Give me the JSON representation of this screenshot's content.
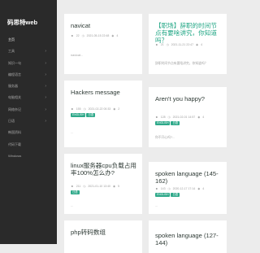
{
  "site": {
    "logo": "码思特web"
  },
  "nav": [
    {
      "label": "主页",
      "active": true,
      "arrow": ""
    },
    {
      "label": "工具",
      "active": false,
      "arrow": "›"
    },
    {
      "label": "知识一句",
      "active": false,
      "arrow": "›"
    },
    {
      "label": "编程语言",
      "active": false,
      "arrow": "›"
    },
    {
      "label": "服务器",
      "active": false,
      "arrow": "›"
    },
    {
      "label": "电脑相关",
      "active": false,
      "arrow": "›"
    },
    {
      "label": "网络杂记",
      "active": false,
      "arrow": "›"
    },
    {
      "label": "日语",
      "active": false,
      "arrow": "›"
    },
    {
      "label": "韩国资料",
      "active": false,
      "arrow": ""
    },
    {
      "label": "代码下载",
      "active": false,
      "arrow": ""
    },
    {
      "label": "Windows",
      "active": false,
      "arrow": ""
    }
  ],
  "cards": [
    {
      "title": "navicat",
      "author": "22",
      "date": "2021-05-15 22:48",
      "views": "4",
      "tags": [],
      "excerpt": "navicat..."
    },
    {
      "title": "【职场】辞职的时间节点有要啥讲究，你知道吗？",
      "author": "21",
      "date": "2021-11-21 22:47",
      "views": "4",
      "tags": [],
      "excerpt": "辞职时间节点有要啥讲究，你知道吗？"
    },
    {
      "title": "Hackers message",
      "author": "155",
      "date": "2021-02-22 00:33",
      "views": "2",
      "tags": [
        "ENGLISH",
        "日语"
      ],
      "excerpt": "..."
    },
    {
      "title": "Aren't you happy?",
      "author": "128",
      "date": "2021-02-01 14:57",
      "views": "4",
      "tags": [
        "ENGLISH",
        "日语"
      ],
      "excerpt": "你不开心吗?..."
    },
    {
      "title": "linux服务器cpu负载占用率100%怎么办?",
      "author": "211",
      "date": "2021-01-10 13:40",
      "views": "5",
      "tags": [
        "日语"
      ],
      "excerpt": "..."
    },
    {
      "title": "spoken language (145-162)",
      "author": "143",
      "date": "2020-12-17 17:14",
      "views": "4",
      "tags": [
        "ENGLISH",
        "日语"
      ],
      "excerpt": "..."
    },
    {
      "title": "php转码数组",
      "author": "",
      "date": "",
      "views": "",
      "tags": [],
      "excerpt": ""
    },
    {
      "title": "spoken language (127-144)",
      "author": "",
      "date": "",
      "views": "",
      "tags": [],
      "excerpt": ""
    }
  ],
  "icons": {
    "author": "person-icon",
    "date": "clock-icon",
    "views": "eye-icon"
  },
  "colors": {
    "sidebar": "#2a2a2a",
    "accent": "#2fa98a",
    "title_teal": "#1ea583",
    "title_dark": "#2f3b36",
    "page_bg": "#ececec"
  }
}
